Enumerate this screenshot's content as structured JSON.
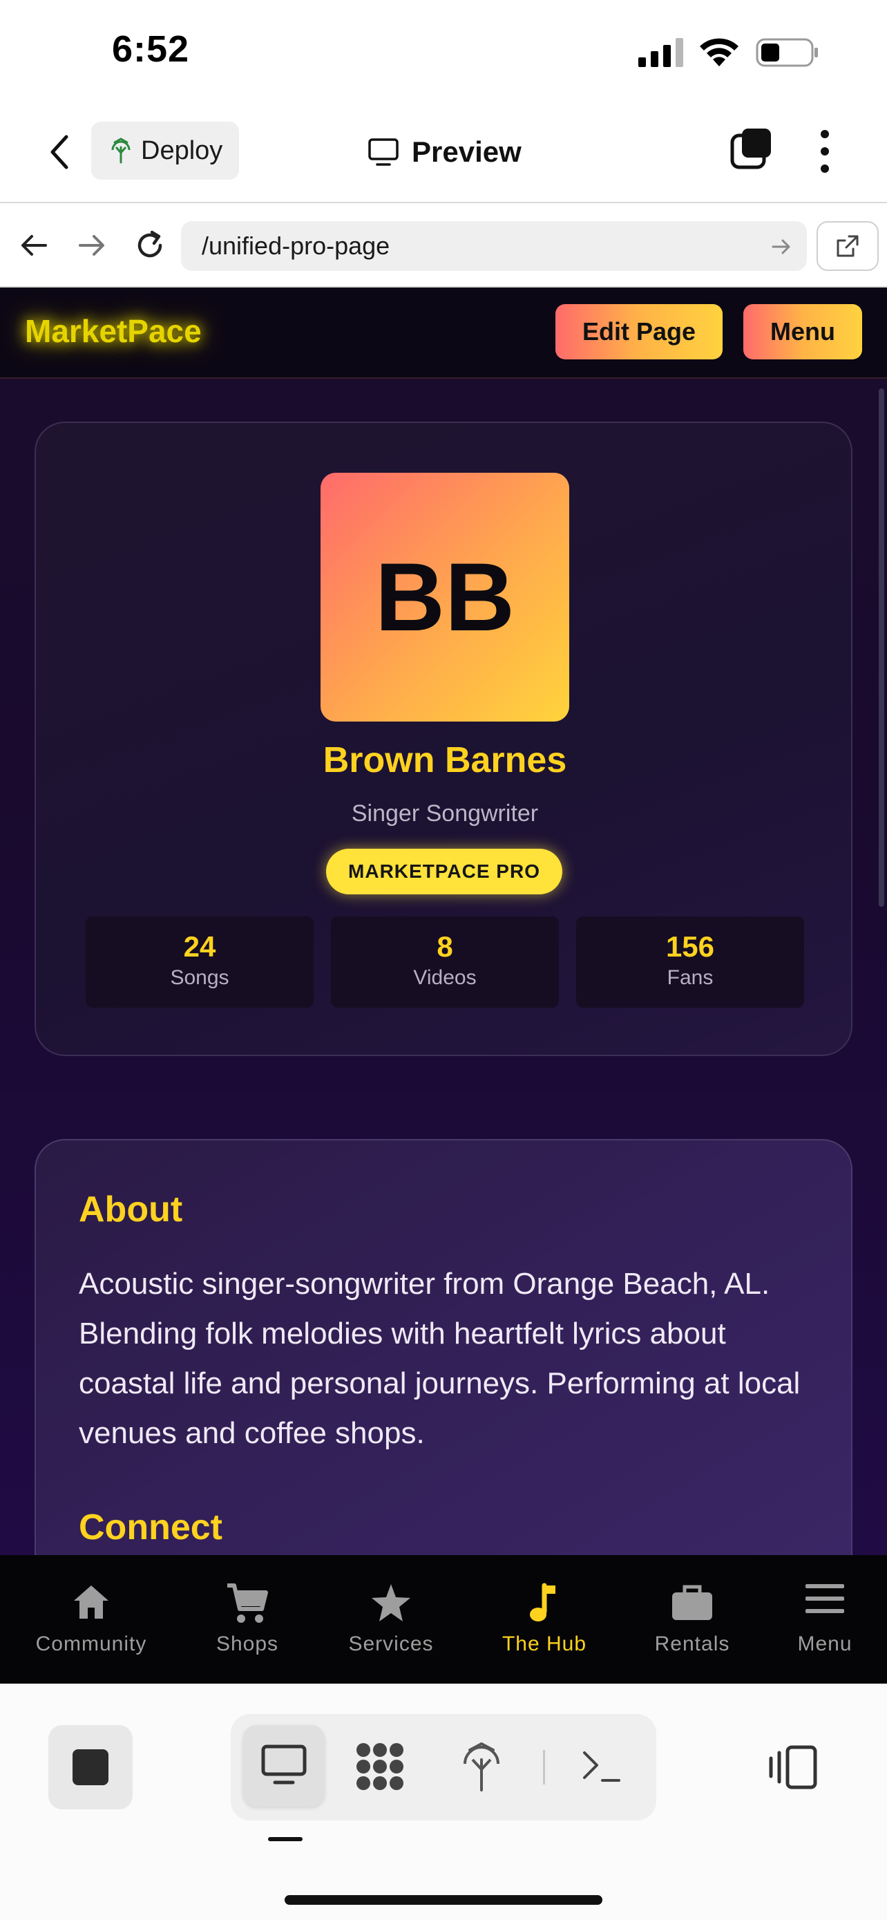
{
  "status_bar": {
    "time": "6:52"
  },
  "header": {
    "deploy_label": "Deploy",
    "preview_label": "Preview"
  },
  "browser": {
    "url": "/unified-pro-page"
  },
  "site": {
    "logo": "MarketPace",
    "edit_button": "Edit Page",
    "menu_button": "Menu",
    "profile": {
      "initials": "BB",
      "name": "Brown Barnes",
      "title": "Singer Songwriter",
      "badge": "MARKETPACE PRO",
      "stats": [
        {
          "value": "24",
          "label": "Songs"
        },
        {
          "value": "8",
          "label": "Videos"
        },
        {
          "value": "156",
          "label": "Fans"
        }
      ]
    },
    "about": {
      "heading": "About",
      "body": "Acoustic singer-songwriter from Orange Beach, AL. Blending folk melodies with heartfelt lyrics about coastal life and personal journeys. Performing at local venues and coffee shops.",
      "connect_heading": "Connect"
    },
    "bottom_nav": [
      {
        "label": "Community",
        "icon": "home-icon"
      },
      {
        "label": "Shops",
        "icon": "cart-icon"
      },
      {
        "label": "Services",
        "icon": "star-icon"
      },
      {
        "label": "The Hub",
        "icon": "music-note-icon",
        "active": true
      },
      {
        "label": "Rentals",
        "icon": "toolbox-icon"
      },
      {
        "label": "Menu",
        "icon": "hamburger-icon"
      }
    ]
  },
  "colors": {
    "accent": "#ffd21f",
    "gradient_start": "#ff6b6b",
    "gradient_end": "#ffd43b",
    "site_bg": "#1a0d2b"
  }
}
